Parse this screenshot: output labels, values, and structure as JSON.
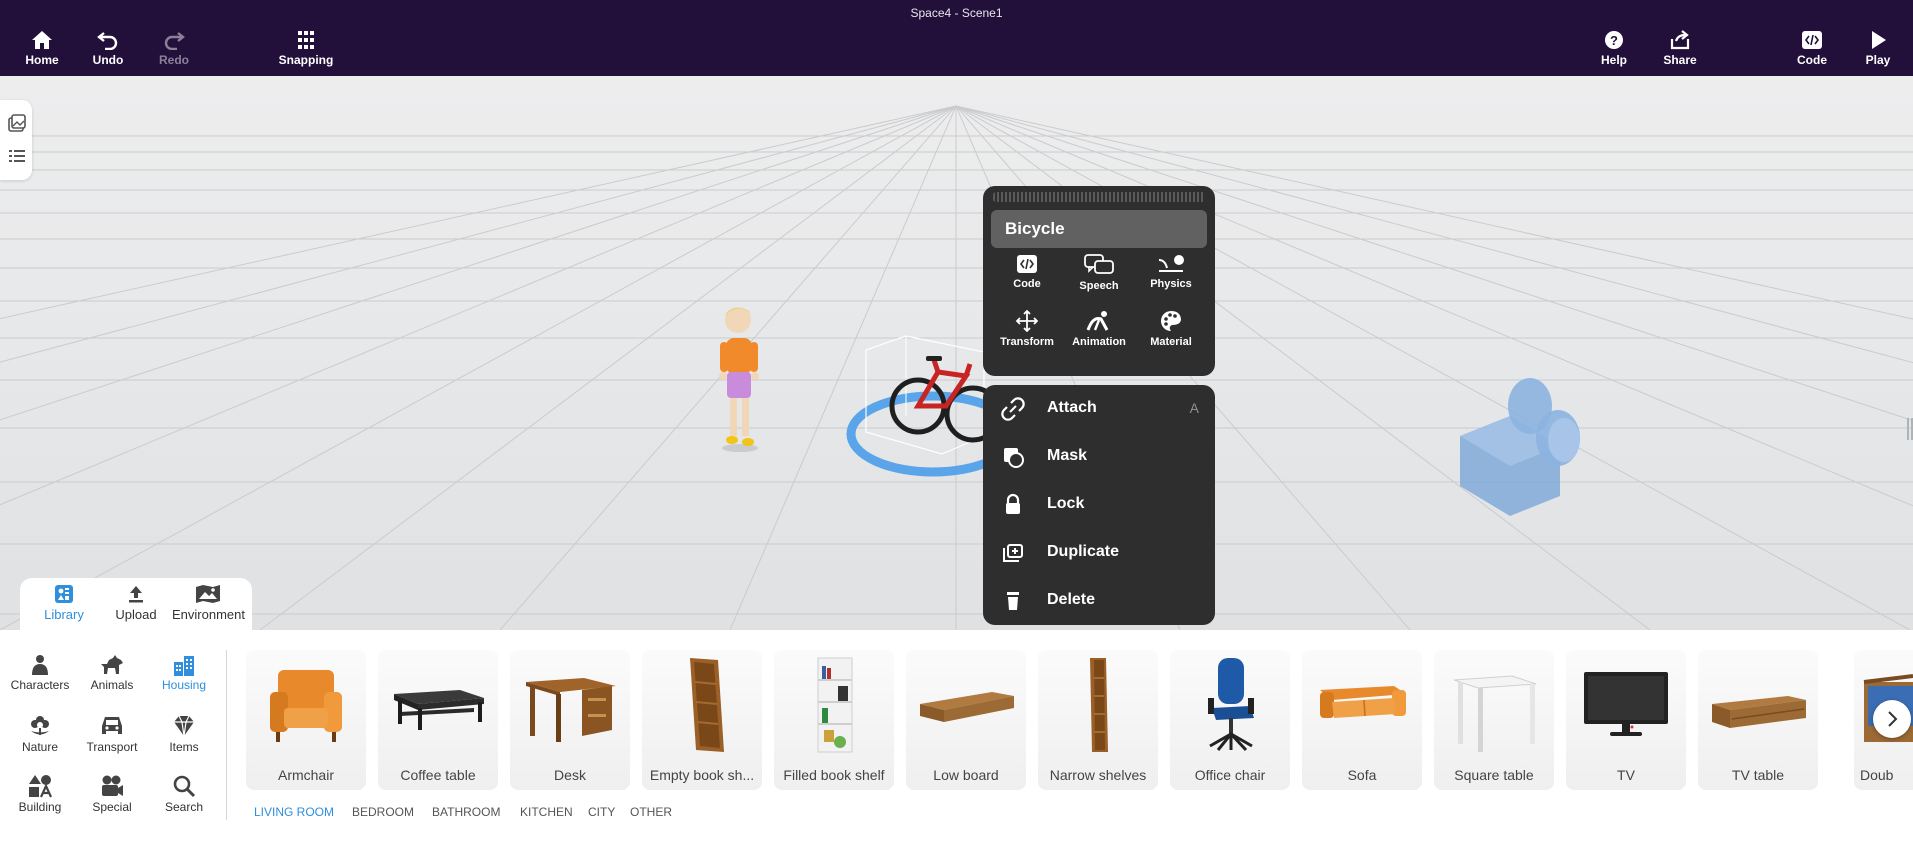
{
  "window": {
    "title": "Space4 - Scene1"
  },
  "toolbar": {
    "home": "Home",
    "undo": "Undo",
    "redo": "Redo",
    "snapping": "Snapping",
    "help": "Help",
    "share": "Share",
    "code": "Code",
    "play": "Play"
  },
  "context_menu": {
    "object_name": "Bicycle",
    "grid": [
      "Code",
      "Speech",
      "Physics",
      "Transform",
      "Animation",
      "Material"
    ],
    "actions": [
      {
        "label": "Attach",
        "shortcut": "A"
      },
      {
        "label": "Mask",
        "shortcut": ""
      },
      {
        "label": "Lock",
        "shortcut": ""
      },
      {
        "label": "Duplicate",
        "shortcut": ""
      },
      {
        "label": "Delete",
        "shortcut": ""
      }
    ]
  },
  "library_tabs": [
    "Library",
    "Upload",
    "Environment"
  ],
  "categories": [
    "Characters",
    "Animals",
    "Housing",
    "Nature",
    "Transport",
    "Items",
    "Building",
    "Special",
    "Search"
  ],
  "items": [
    "Armchair",
    "Coffee table",
    "Desk",
    "Empty book sh...",
    "Filled book shelf",
    "Low board",
    "Narrow shelves",
    "Office chair",
    "Sofa",
    "Square table",
    "TV",
    "TV table",
    "Doub"
  ],
  "subcategories": [
    "LIVING ROOM",
    "BEDROOM",
    "BATHROOM",
    "KITCHEN",
    "CITY",
    "OTHER"
  ],
  "colors": {
    "topbar": "#23103a",
    "accent": "#2f8fdc",
    "menu": "#2e2e2e"
  }
}
